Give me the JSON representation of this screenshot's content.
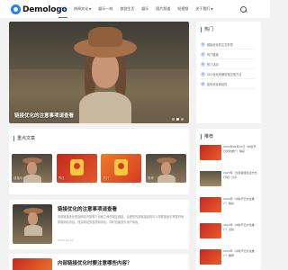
{
  "brand": {
    "logo_text": "Demologo",
    "accent": "#1e80ff"
  },
  "nav": {
    "items": [
      {
        "label": "首页",
        "active": true
      },
      {
        "label": "热闻文化",
        "has_menu": true
      },
      {
        "label": "娱乐一刻",
        "has_menu": false
      },
      {
        "label": "旅游生活",
        "has_menu": false
      },
      {
        "label": "娱乐",
        "has_menu": false
      },
      {
        "label": "图片频道",
        "has_menu": false
      },
      {
        "label": "短视频",
        "has_menu": false
      },
      {
        "label": "关于我们",
        "has_menu": true
      }
    ],
    "search_icon": "search-icon"
  },
  "hero": {
    "caption": "链接优化的注意事项请查看",
    "dots": 3,
    "active_dot": 1
  },
  "hot": {
    "title": "热门",
    "items": [
      {
        "num": "1",
        "text": "链接优化的注意事项"
      },
      {
        "num": "2",
        "text": "内门链接"
      },
      {
        "num": "3",
        "text": "热门活动"
      },
      {
        "num": "4",
        "text": "SEO优化有哪些常见的方法"
      },
      {
        "num": "5",
        "text": "如何优化网站的"
      }
    ]
  },
  "recommended": {
    "title": "重点文章",
    "thumbs": [
      {
        "caption": "链接优化",
        "style": "girl"
      },
      {
        "caption": "节日",
        "style": "red"
      },
      {
        "caption": "热门",
        "style": "orange"
      },
      {
        "caption": "推荐",
        "style": "girl"
      }
    ]
  },
  "articles": [
    {
      "title": "链接优化的注意事项请查看",
      "excerpt": "内部链接优化是指网站内部各个页面之间的相互链接，合理的内部链接结构可以帮助搜索引擎更好地抓取网站内容，提高网站的权重和排名，同时也能提升用户体验。",
      "meta": "2023-04-15"
    },
    {
      "title": "内部链接优化时要注意哪些内容？"
    }
  ],
  "side_recommend": {
    "title": "推荐",
    "items": [
      {
        "text": "2023年05月15日（中秋节日文化推广）精彩",
        "style": "red"
      },
      {
        "text": "2023年（全民健康生活方式行动）分享",
        "style": "girl"
      },
      {
        "text": "2023年（中秋节日文化推广）精彩",
        "style": "red"
      },
      {
        "text": "2023年（中秋节日文化推广）活动",
        "style": "red"
      },
      {
        "text": "2023年（中秋节日文化推广）推荐",
        "style": "red"
      }
    ]
  }
}
